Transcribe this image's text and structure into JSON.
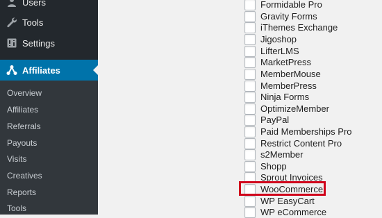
{
  "sidebar": {
    "users_label": "Users",
    "tools_label": "Tools",
    "settings_label": "Settings",
    "affiliates_label": "Affiliates",
    "submenu": [
      "Overview",
      "Affiliates",
      "Referrals",
      "Payouts",
      "Visits",
      "Creatives",
      "Reports",
      "Tools"
    ]
  },
  "integrations": [
    "Formidable Pro",
    "Gravity Forms",
    "iThemes Exchange",
    "Jigoshop",
    "LifterLMS",
    "MarketPress",
    "MemberMouse",
    "MemberPress",
    "Ninja Forms",
    "OptimizeMember",
    "PayPal",
    "Paid Memberships Pro",
    "Restrict Content Pro",
    "s2Member",
    "Shopp",
    "Sprout Invoices",
    "WooCommerce",
    "WP EasyCart",
    "WP eCommerce"
  ],
  "colors": {
    "admin_bar": "#23282d",
    "active_menu": "#0073aa",
    "highlight": "#d0021b"
  },
  "icons": {
    "users": "users-icon",
    "tools": "wrench-icon",
    "settings": "settings-icon",
    "affiliates": "affiliates-network-icon"
  }
}
